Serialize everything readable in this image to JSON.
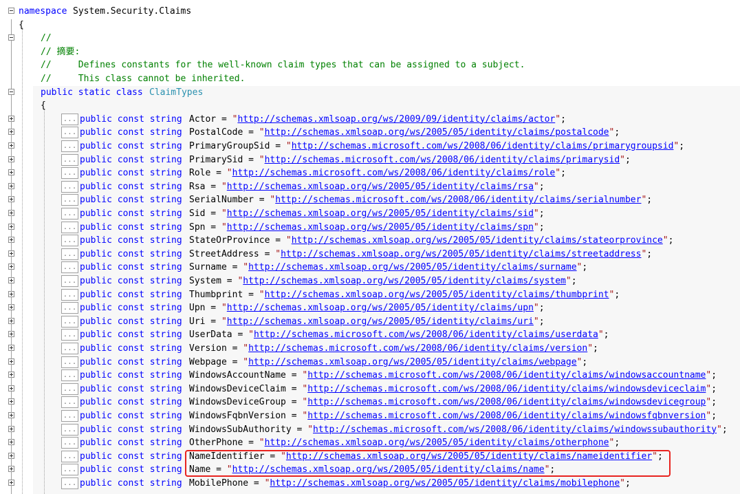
{
  "editor": {
    "namespace_keyword": "namespace",
    "namespace_name": "System.Security.Claims",
    "open_brace": "{",
    "comment_lines": [
      "//",
      "// 摘要:",
      "//     Defines constants for the well-known claim types that can be assigned to a subject.",
      "//     This class cannot be inherited."
    ],
    "class_modifiers": "public static class",
    "class_name": "ClaimTypes",
    "class_open_brace": "{",
    "collapsed_marker": "...",
    "member_prefix": "public const string",
    "members": [
      {
        "name": "Actor",
        "url": "http://schemas.xmlsoap.org/ws/2009/09/identity/claims/actor"
      },
      {
        "name": "PostalCode",
        "url": "http://schemas.xmlsoap.org/ws/2005/05/identity/claims/postalcode"
      },
      {
        "name": "PrimaryGroupSid",
        "url": "http://schemas.microsoft.com/ws/2008/06/identity/claims/primarygroupsid"
      },
      {
        "name": "PrimarySid",
        "url": "http://schemas.microsoft.com/ws/2008/06/identity/claims/primarysid"
      },
      {
        "name": "Role",
        "url": "http://schemas.microsoft.com/ws/2008/06/identity/claims/role"
      },
      {
        "name": "Rsa",
        "url": "http://schemas.xmlsoap.org/ws/2005/05/identity/claims/rsa"
      },
      {
        "name": "SerialNumber",
        "url": "http://schemas.microsoft.com/ws/2008/06/identity/claims/serialnumber"
      },
      {
        "name": "Sid",
        "url": "http://schemas.xmlsoap.org/ws/2005/05/identity/claims/sid"
      },
      {
        "name": "Spn",
        "url": "http://schemas.xmlsoap.org/ws/2005/05/identity/claims/spn"
      },
      {
        "name": "StateOrProvince",
        "url": "http://schemas.xmlsoap.org/ws/2005/05/identity/claims/stateorprovince"
      },
      {
        "name": "StreetAddress",
        "url": "http://schemas.xmlsoap.org/ws/2005/05/identity/claims/streetaddress"
      },
      {
        "name": "Surname",
        "url": "http://schemas.xmlsoap.org/ws/2005/05/identity/claims/surname"
      },
      {
        "name": "System",
        "url": "http://schemas.xmlsoap.org/ws/2005/05/identity/claims/system"
      },
      {
        "name": "Thumbprint",
        "url": "http://schemas.xmlsoap.org/ws/2005/05/identity/claims/thumbprint"
      },
      {
        "name": "Upn",
        "url": "http://schemas.xmlsoap.org/ws/2005/05/identity/claims/upn"
      },
      {
        "name": "Uri",
        "url": "http://schemas.xmlsoap.org/ws/2005/05/identity/claims/uri"
      },
      {
        "name": "UserData",
        "url": "http://schemas.microsoft.com/ws/2008/06/identity/claims/userdata"
      },
      {
        "name": "Version",
        "url": "http://schemas.microsoft.com/ws/2008/06/identity/claims/version"
      },
      {
        "name": "Webpage",
        "url": "http://schemas.xmlsoap.org/ws/2005/05/identity/claims/webpage"
      },
      {
        "name": "WindowsAccountName",
        "url": "http://schemas.microsoft.com/ws/2008/06/identity/claims/windowsaccountname"
      },
      {
        "name": "WindowsDeviceClaim",
        "url": "http://schemas.microsoft.com/ws/2008/06/identity/claims/windowsdeviceclaim"
      },
      {
        "name": "WindowsDeviceGroup",
        "url": "http://schemas.microsoft.com/ws/2008/06/identity/claims/windowsdevicegroup"
      },
      {
        "name": "WindowsFqbnVersion",
        "url": "http://schemas.microsoft.com/ws/2008/06/identity/claims/windowsfqbnversion"
      },
      {
        "name": "WindowsSubAuthority",
        "url": "http://schemas.microsoft.com/ws/2008/06/identity/claims/windowssubauthority"
      },
      {
        "name": "OtherPhone",
        "url": "http://schemas.xmlsoap.org/ws/2005/05/identity/claims/otherphone"
      },
      {
        "name": "NameIdentifier",
        "url": "http://schemas.xmlsoap.org/ws/2005/05/identity/claims/nameidentifier"
      },
      {
        "name": "Name",
        "url": "http://schemas.xmlsoap.org/ws/2005/05/identity/claims/name"
      },
      {
        "name": "MobilePhone",
        "url": "http://schemas.xmlsoap.org/ws/2005/05/identity/claims/mobilephone"
      }
    ],
    "highlighted_members": [
      "NameIdentifier",
      "Name"
    ]
  },
  "colors": {
    "keyword": "#0000ff",
    "comment": "#008000",
    "type": "#2b91af",
    "string": "#a31515",
    "highlight_border": "#e8231f"
  },
  "icons": {
    "expanded": "outline-collapse-icon",
    "collapsed": "outline-expand-icon"
  }
}
